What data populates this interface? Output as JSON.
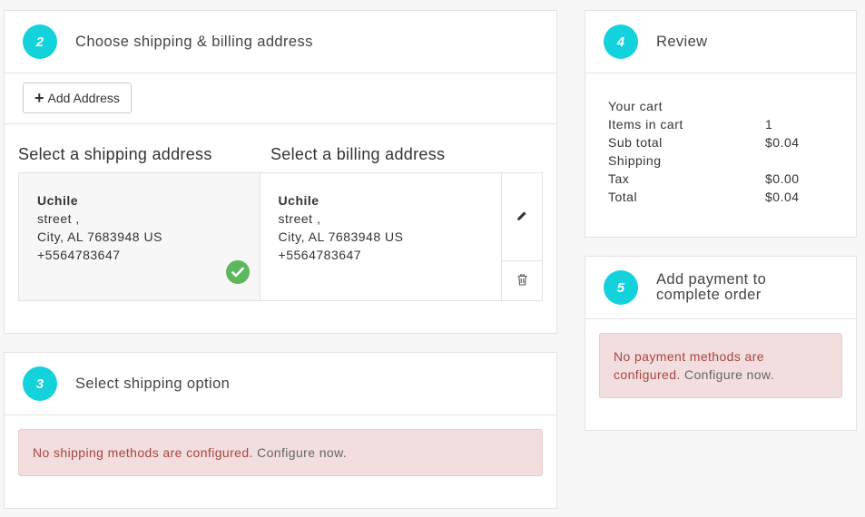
{
  "shipping_billing": {
    "step": "2",
    "title": "Choose shipping & billing address",
    "add_address_label": "Add Address",
    "shipping_heading": "Select a shipping address",
    "billing_heading": "Select a billing address",
    "shipping_address": {
      "name": "Uchile",
      "street": "street ,",
      "city": "City, AL 7683948 US",
      "phone": "+5564783647"
    },
    "billing_address": {
      "name": "Uchile",
      "street": "street ,",
      "city": "City, AL 7683948 US",
      "phone": "+5564783647"
    },
    "icons": [
      "plus-icon",
      "check-circle-icon",
      "pencil-icon",
      "trash-icon"
    ]
  },
  "shipping_option": {
    "step": "3",
    "title": "Select shipping option",
    "alert_text": "No shipping methods are configured.",
    "alert_link": "Configure now."
  },
  "review": {
    "step": "4",
    "title": "Review",
    "heading": "Your cart",
    "rows": [
      {
        "label": "Items in cart",
        "value": "1"
      },
      {
        "label": "Sub total",
        "value": "$0.04"
      },
      {
        "label": "Shipping",
        "value": ""
      },
      {
        "label": "Tax",
        "value": "$0.00"
      },
      {
        "label": "Total",
        "value": "$0.04"
      }
    ]
  },
  "payment": {
    "step": "5",
    "title_line1": "Add payment to",
    "title_line2": "complete order",
    "alert_line1": "No payment methods are",
    "alert_text2": "configured.",
    "alert_link": "Configure now."
  },
  "colors": {
    "accent": "#14d2dc",
    "success": "#5cb85c",
    "alert_bg": "#f2dede",
    "alert_text": "#a94442"
  }
}
